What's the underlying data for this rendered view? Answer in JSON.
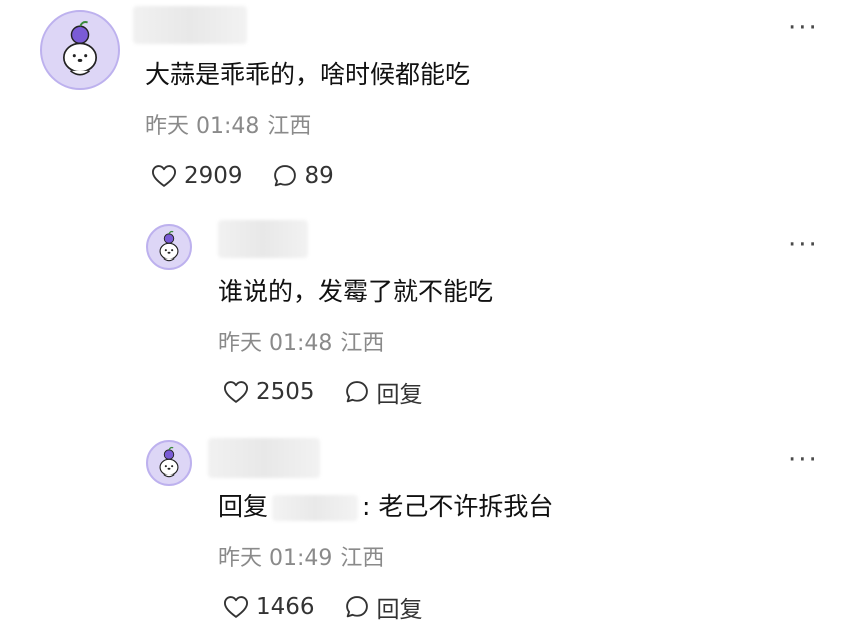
{
  "comments": [
    {
      "content": "大蒜是乖乖的，啥时候都能吃",
      "time": "昨天 01:48",
      "location": "江西",
      "likes": "2909",
      "reply_label": "89"
    },
    {
      "content": "谁说的，发霉了就不能吃",
      "time": "昨天 01:48",
      "location": "江西",
      "likes": "2505",
      "reply_label": "回复"
    },
    {
      "reply_prefix": "回复",
      "content": ": 老己不许拆我台",
      "time": "昨天 01:49",
      "location": "江西",
      "likes": "1466",
      "reply_label": "回复"
    }
  ],
  "more_label": "···",
  "icons": {
    "like": "heart-outline-icon",
    "reply": "speech-bubble-icon",
    "more": "ellipsis-icon"
  },
  "colors": {
    "avatar_bg": "#ddd6f6",
    "avatar_border": "#bdb1ee",
    "meta_text": "#8a8a8a"
  }
}
